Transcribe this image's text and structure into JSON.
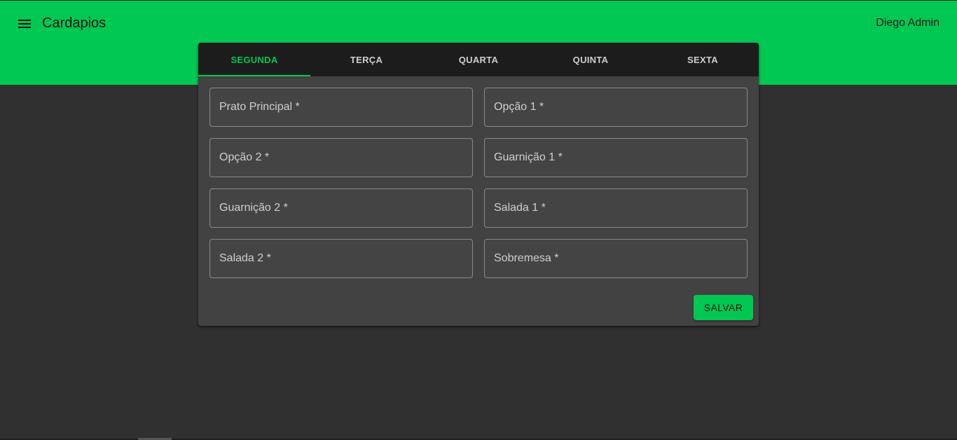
{
  "header": {
    "menu_icon": "menu-icon",
    "title": "Cardapios",
    "user": "Diego Admin"
  },
  "tabs": [
    {
      "label": "SEGUNDA",
      "active": true
    },
    {
      "label": "TERÇA",
      "active": false
    },
    {
      "label": "QUARTA",
      "active": false
    },
    {
      "label": "QUINTA",
      "active": false
    },
    {
      "label": "SEXTA",
      "active": false
    }
  ],
  "form": {
    "fields": [
      {
        "placeholder": "Prato Principal *",
        "value": ""
      },
      {
        "placeholder": "Opção 1 *",
        "value": ""
      },
      {
        "placeholder": "Opção 2 *",
        "value": ""
      },
      {
        "placeholder": "Guarnição 1 *",
        "value": ""
      },
      {
        "placeholder": "Guarnição 2 *",
        "value": ""
      },
      {
        "placeholder": "Salada 1 *",
        "value": ""
      },
      {
        "placeholder": "Salada 2 *",
        "value": ""
      },
      {
        "placeholder": "Sobremesa *",
        "value": ""
      }
    ],
    "save_label": "SALVAR"
  },
  "colors": {
    "accent": "#00c853",
    "background": "#303030",
    "card": "#424242",
    "tab_bar": "#1c1c1c"
  }
}
